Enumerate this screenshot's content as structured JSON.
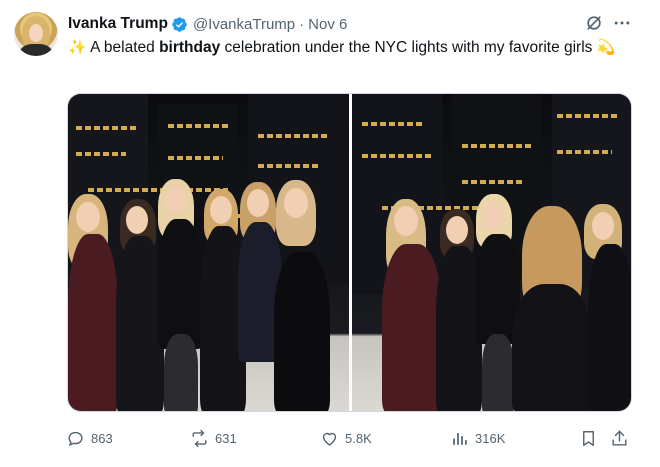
{
  "author": {
    "display_name": "Ivanka Trump",
    "handle": "@IvankaTrump",
    "separator": "·",
    "date": "Nov 6"
  },
  "tweet": {
    "emoji_start": "✨",
    "text_before": " A belated ",
    "text_bold": "birthday",
    "text_after": " celebration under the NYC lights with my favorite girls ",
    "emoji_end": "💫"
  },
  "actions": {
    "replies": "863",
    "reposts": "631",
    "likes": "5.8K",
    "views": "316K"
  },
  "icons": {
    "verified": "verified-badge-icon",
    "grok": "grok-icon",
    "more": "more-icon",
    "reply": "reply-icon",
    "repost": "repost-icon",
    "like": "heart-icon",
    "views": "views-icon",
    "bookmark": "bookmark-icon",
    "share": "share-icon"
  },
  "colors": {
    "verified": "#1d9bf0",
    "text": "#0f1419",
    "secondary": "#536471"
  }
}
